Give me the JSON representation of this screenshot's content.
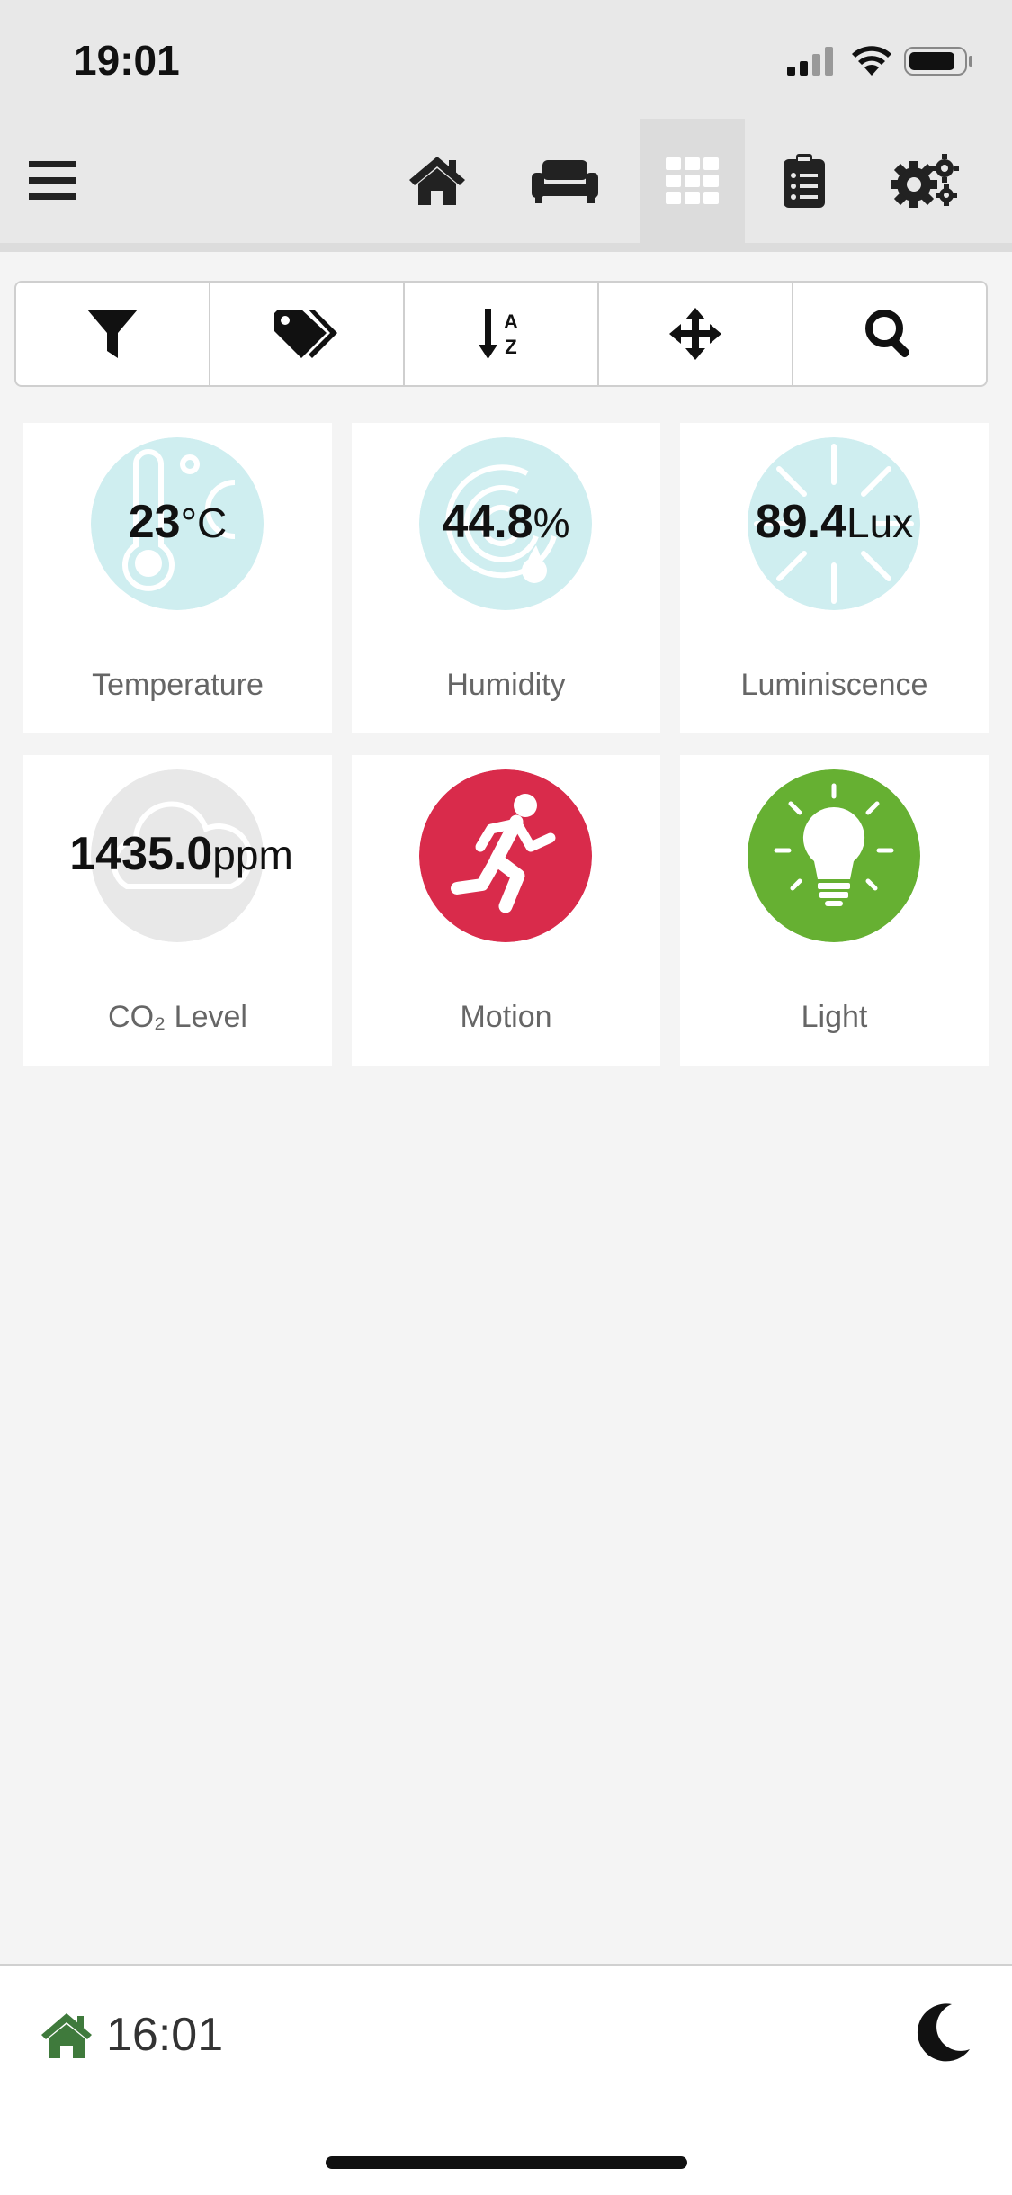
{
  "status_bar": {
    "time": "19:01"
  },
  "nav": {
    "items": [
      "menu-icon",
      "home-icon",
      "couch-icon",
      "grid-icon",
      "clipboard-icon",
      "gears-icon"
    ],
    "active": "grid-icon"
  },
  "toolbar": {
    "items": [
      "filter-icon",
      "tags-icon",
      "sort-alpha-icon",
      "move-arrows-icon",
      "search-icon"
    ]
  },
  "tiles": [
    {
      "label": "Temperature",
      "value": "23",
      "unit": "°C",
      "icon": "thermometer-icon",
      "color": "#cfeef0"
    },
    {
      "label": "Humidity",
      "value": "44.8",
      "unit": "%",
      "icon": "humidity-icon",
      "color": "#cfeef0"
    },
    {
      "label": "Luminiscence",
      "value": "89.4",
      "unit": "Lux",
      "icon": "sun-icon",
      "color": "#cfeef0"
    },
    {
      "label": "CO₂ Level",
      "value": "1435.0",
      "unit": "ppm",
      "icon": "cloud-icon",
      "color": "#e8e8e8"
    },
    {
      "label": "Motion",
      "value": "",
      "unit": "",
      "icon": "running-person-icon",
      "color": "#d92b4b"
    },
    {
      "label": "Light",
      "value": "",
      "unit": "",
      "icon": "lightbulb-icon",
      "color": "#66b032"
    }
  ],
  "footer": {
    "time": "16:01",
    "home_color": "#3f7a3c"
  }
}
